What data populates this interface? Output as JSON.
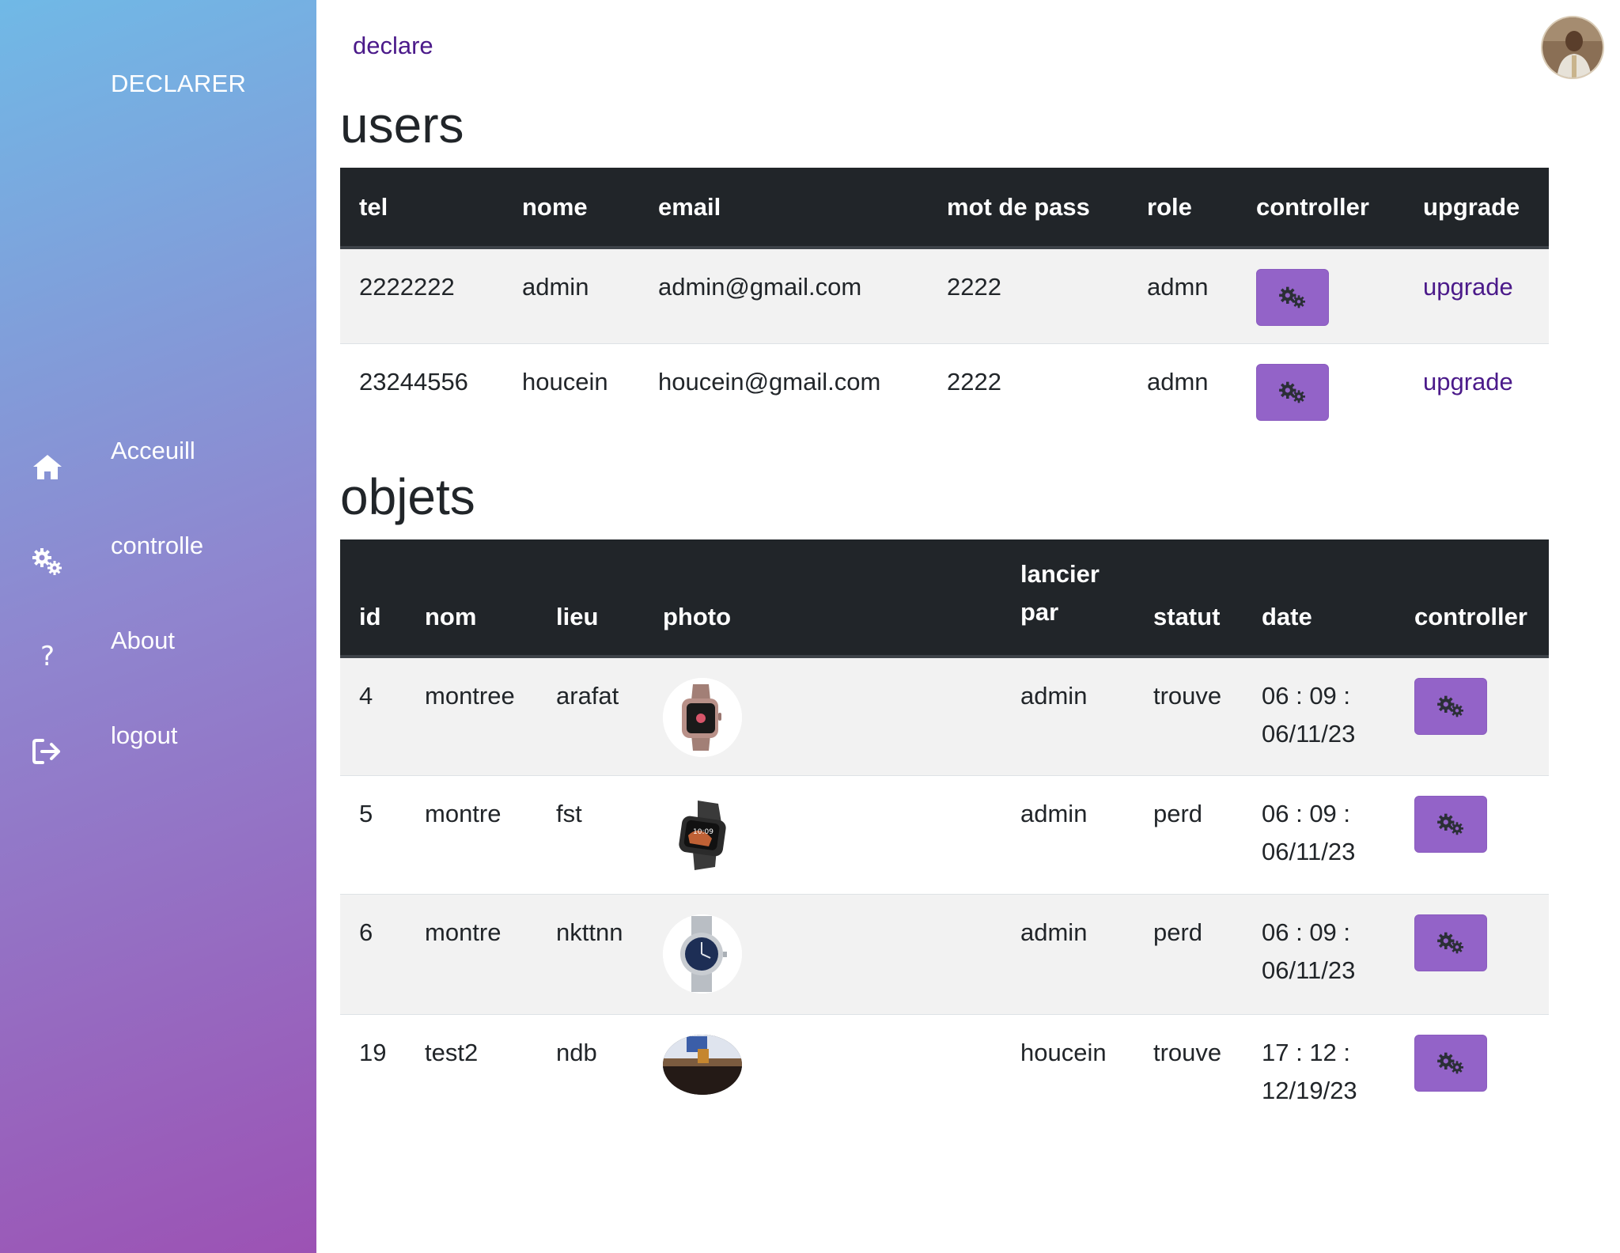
{
  "sidebar": {
    "brand": "DECLARER",
    "items": [
      {
        "label": "Acceuill",
        "icon": "home-icon"
      },
      {
        "label": "controlle",
        "icon": "gears-icon"
      },
      {
        "label": "About",
        "icon": "question-icon"
      },
      {
        "label": "logout",
        "icon": "logout-icon"
      }
    ]
  },
  "header": {
    "link": "declare",
    "avatar": "user-avatar"
  },
  "users": {
    "title": "users",
    "columns": [
      "tel",
      "nome",
      "email",
      "mot de pass",
      "role",
      "controller",
      "upgrade"
    ],
    "rows": [
      {
        "tel": "2222222",
        "nome": "admin",
        "email": "admin@gmail.com",
        "pass": "2222",
        "role": "admn",
        "upgrade": "upgrade"
      },
      {
        "tel": "23244556",
        "nome": "houcein",
        "email": "houcein@gmail.com",
        "pass": "2222",
        "role": "admn",
        "upgrade": "upgrade"
      }
    ]
  },
  "objets": {
    "title": "objets",
    "columns": [
      "id",
      "nom",
      "lieu",
      "photo",
      "lancier par",
      "statut",
      "date",
      "controller"
    ],
    "rows": [
      {
        "id": "4",
        "nom": "montree",
        "lieu": "arafat",
        "photo": "pink-smartwatch-photo",
        "par": "admin",
        "statut": "trouve",
        "date1": "06 : 09 :",
        "date2": "06/11/23"
      },
      {
        "id": "5",
        "nom": "montre",
        "lieu": "fst",
        "photo": "black-smartwatch-photo",
        "par": "admin",
        "statut": "perd",
        "date1": "06 : 09 :",
        "date2": "06/11/23"
      },
      {
        "id": "6",
        "nom": "montre",
        "lieu": "nkttnn",
        "photo": "steel-watch-photo",
        "par": "admin",
        "statut": "perd",
        "date1": "06 : 09 :",
        "date2": "06/11/23"
      },
      {
        "id": "19",
        "nom": "test2",
        "lieu": "ndb",
        "photo": "room-photo",
        "par": "houcein",
        "statut": "trouve",
        "date1": "17 : 12 :",
        "date2": "12/19/23"
      }
    ]
  },
  "colors": {
    "sidebar_gradient": [
      "#70b9e6",
      "#8f86cf",
      "#9c52b4"
    ],
    "table_header": "#212529",
    "action_button": "#9363c8",
    "link": "#4b1a8a"
  }
}
